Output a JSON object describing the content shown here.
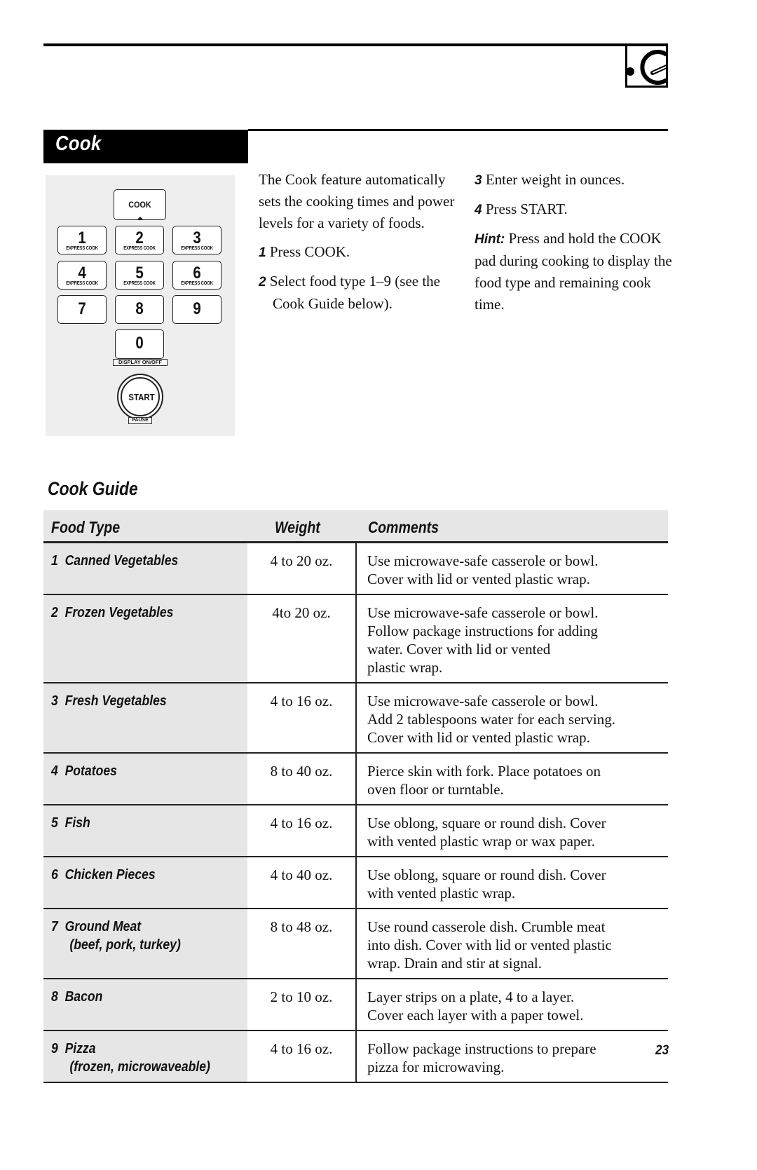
{
  "header": {
    "logo_icon": "ge-monogram-icon"
  },
  "section": {
    "title": "Cook"
  },
  "keypad": {
    "cook_key": "COOK",
    "number_keys": [
      {
        "digit": "1",
        "sub": "EXPRESS COOK"
      },
      {
        "digit": "2",
        "sub": "EXPRESS COOK"
      },
      {
        "digit": "3",
        "sub": "EXPRESS COOK"
      },
      {
        "digit": "4",
        "sub": "EXPRESS COOK"
      },
      {
        "digit": "5",
        "sub": "EXPRESS COOK"
      },
      {
        "digit": "6",
        "sub": "EXPRESS COOK"
      },
      {
        "digit": "7",
        "sub": ""
      },
      {
        "digit": "8",
        "sub": ""
      },
      {
        "digit": "9",
        "sub": ""
      },
      {
        "digit": "0",
        "sub": ""
      }
    ],
    "display_label": "DISPLAY ON/OFF",
    "start_key": "START",
    "pause_label": "PAUSE"
  },
  "intro": {
    "paragraph": "The Cook feature automatically sets the cooking times and power levels for a variety of foods.",
    "steps": [
      {
        "num": "1",
        "text": "Press COOK."
      },
      {
        "num": "2",
        "text": "Select food type 1–9 (see the Cook Guide below)."
      },
      {
        "num": "3",
        "text": "Enter weight in ounces."
      },
      {
        "num": "4",
        "text": "Press START."
      }
    ],
    "hint_label": "Hint:",
    "hint_text": "Press and hold the COOK pad during cooking to display the food type and remaining cook time."
  },
  "guide": {
    "title": "Cook Guide",
    "headers": {
      "food_type": "Food Type",
      "weight": "Weight",
      "comments": "Comments"
    },
    "rows": [
      {
        "food": "1  Canned Vegetables",
        "sub": "",
        "weight": "4 to 20 oz.",
        "comments": [
          "Use microwave-safe casserole or bowl.",
          "Cover with lid or vented plastic wrap."
        ]
      },
      {
        "food": "2  Frozen Vegetables",
        "sub": "",
        "weight": "4to 20 oz.",
        "comments": [
          "Use microwave-safe casserole or bowl.",
          "Follow package instructions for adding",
          "water. Cover with lid or vented",
          "plastic wrap."
        ]
      },
      {
        "food": "3  Fresh Vegetables",
        "sub": "",
        "weight": "4 to 16 oz.",
        "comments": [
          "Use microwave-safe casserole or bowl.",
          "Add 2 tablespoons water for each serving.",
          "Cover with lid or vented plastic wrap."
        ]
      },
      {
        "food": "4  Potatoes",
        "sub": "",
        "weight": "8 to 40 oz.",
        "comments": [
          "Pierce skin with fork. Place potatoes on",
          "oven floor or turntable."
        ]
      },
      {
        "food": "5  Fish",
        "sub": "",
        "weight": "4 to 16 oz.",
        "comments": [
          "Use oblong, square or round dish. Cover",
          "with vented plastic wrap or wax paper."
        ]
      },
      {
        "food": "6  Chicken Pieces",
        "sub": "",
        "weight": "4 to 40 oz.",
        "comments": [
          "Use oblong, square or round dish. Cover",
          "with vented plastic wrap."
        ]
      },
      {
        "food": "7  Ground Meat",
        "sub": "(beef, pork, turkey)",
        "weight": "8 to 48 oz.",
        "comments": [
          "Use round casserole dish. Crumble meat",
          "into dish. Cover with lid or vented plastic",
          "wrap. Drain and stir at signal."
        ]
      },
      {
        "food": "8  Bacon",
        "sub": "",
        "weight": "2 to 10 oz.",
        "comments": [
          "Layer strips on a plate, 4 to a layer.",
          "Cover each layer with a paper towel."
        ]
      },
      {
        "food": "9  Pizza",
        "sub": "(frozen, microwaveable)",
        "weight": "4 to 16 oz.",
        "comments": [
          "Follow package instructions to prepare",
          "pizza for microwaving."
        ]
      }
    ]
  },
  "footer": {
    "page_number": "23"
  }
}
